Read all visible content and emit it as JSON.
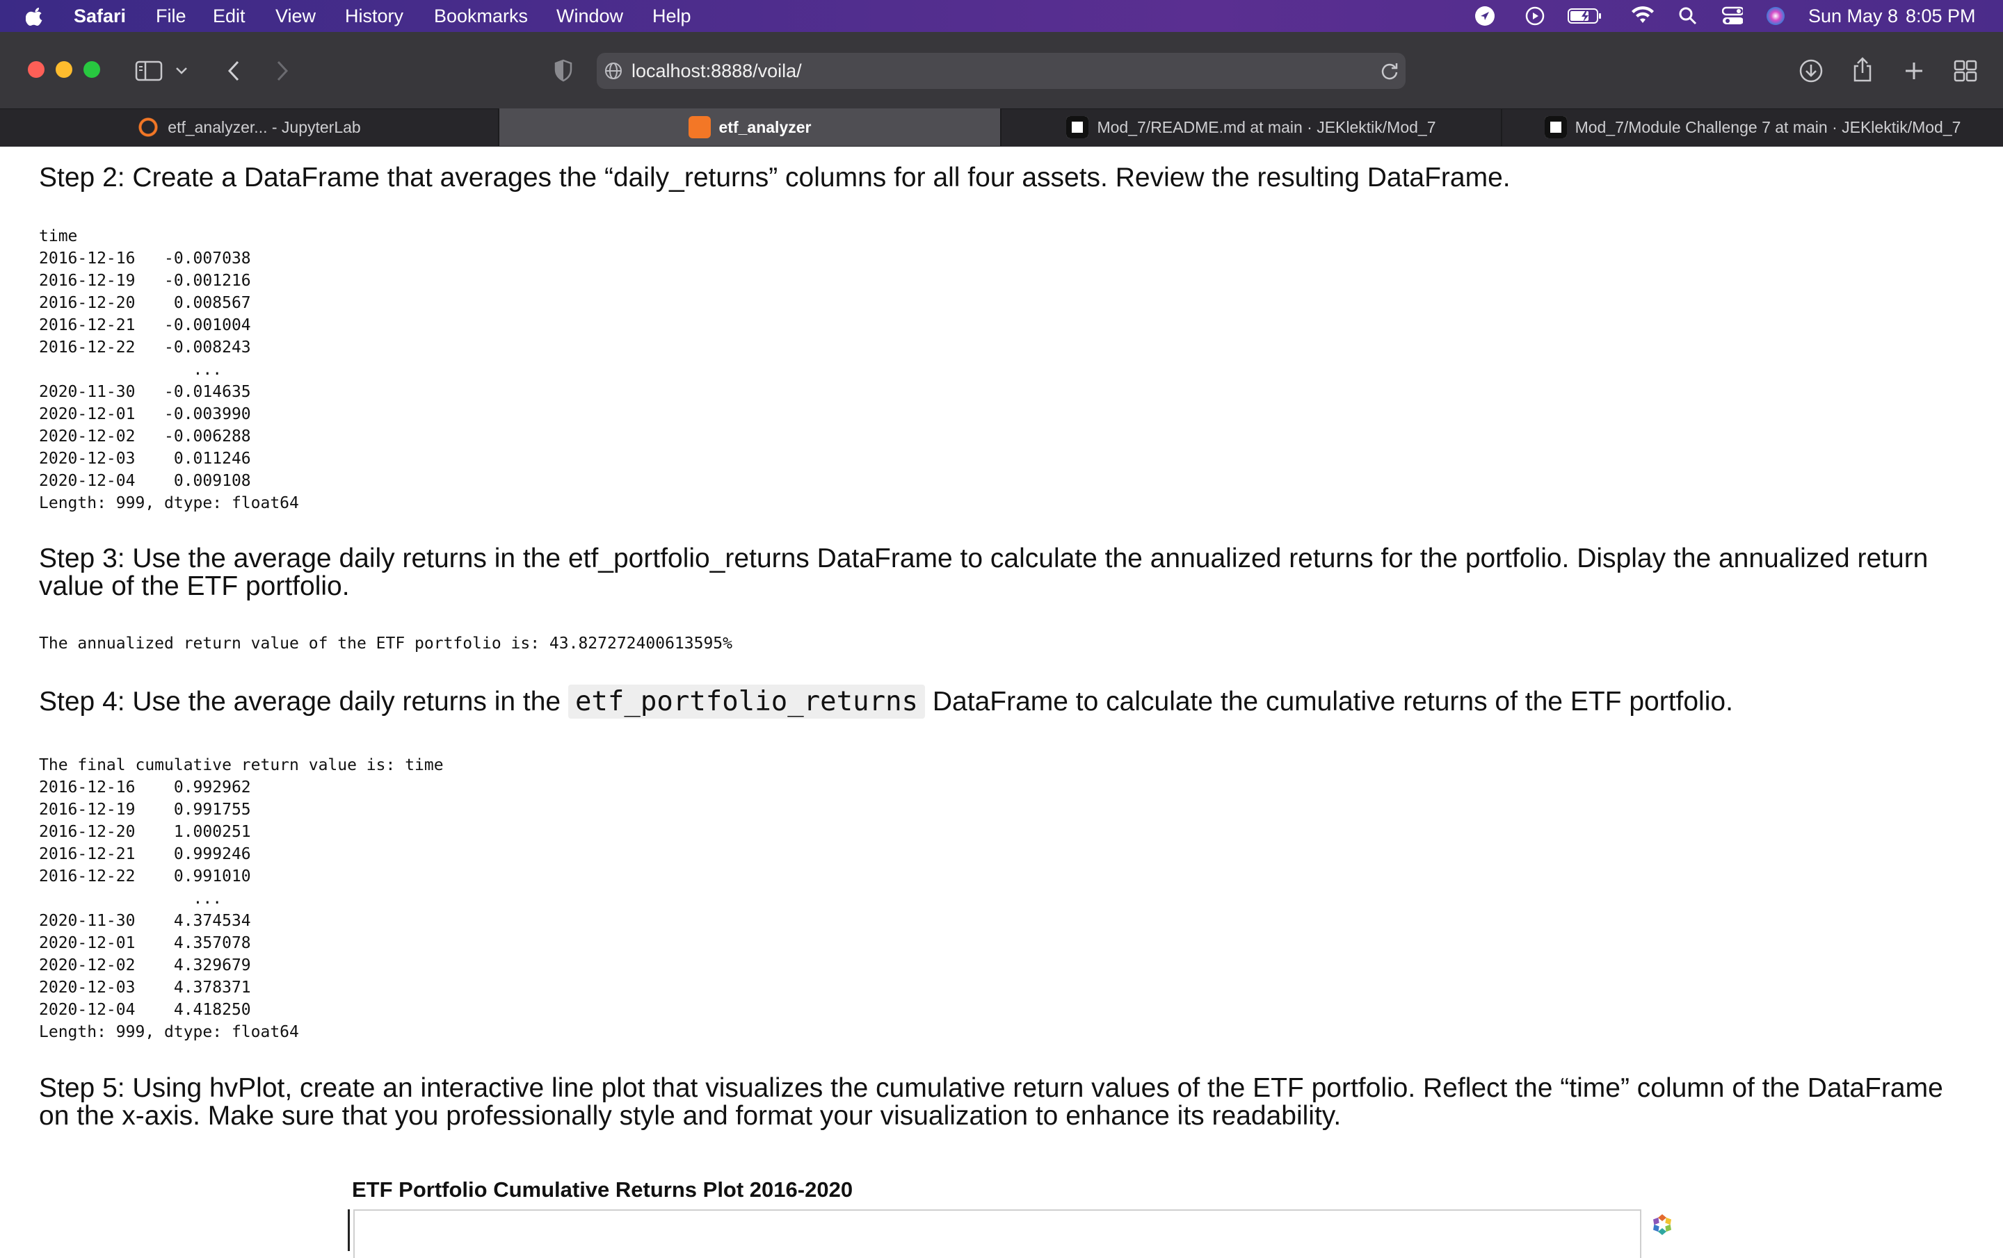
{
  "menubar": {
    "app": "Safari",
    "items": [
      "File",
      "Edit",
      "View",
      "History",
      "Bookmarks",
      "Window",
      "Help"
    ],
    "date": "Sun May 8",
    "time": "8:05 PM",
    "icons": [
      "apple-icon",
      "location-icon",
      "play-icon",
      "battery-icon",
      "wifi-icon",
      "search-icon",
      "control-center-icon",
      "siri-icon"
    ]
  },
  "toolbar": {
    "url": "localhost:8888/voila/"
  },
  "tabs": [
    {
      "label": "etf_analyzer... - JupyterLab",
      "icon": "jupyter-icon"
    },
    {
      "label": "etf_analyzer",
      "icon": "jupyter-icon"
    },
    {
      "label": "Mod_7/README.md at main · JEKlektik/Mod_7",
      "icon": "github-icon"
    },
    {
      "label": "Mod_7/Module Challenge 7 at main · JEKlektik/Mod_7",
      "icon": "github-icon"
    }
  ],
  "content": {
    "step2": {
      "heading": "Step 2: Create a DataFrame that averages the “daily_returns” columns for all four assets. Review the resulting DataFrame.",
      "output": "time\n2016-12-16   -0.007038\n2016-12-19   -0.001216\n2016-12-20    0.008567\n2016-12-21   -0.001004\n2016-12-22   -0.008243\n                ...\n2020-11-30   -0.014635\n2020-12-01   -0.003990\n2020-12-02   -0.006288\n2020-12-03    0.011246\n2020-12-04    0.009108\nLength: 999, dtype: float64"
    },
    "step3": {
      "heading": "Step 3: Use the average daily returns in the etf_portfolio_returns DataFrame to calculate the annualized returns for the portfolio. Display the annualized return value of the ETF portfolio.",
      "output": "The annualized return value of the ETF portfolio is: 43.827272400613595%"
    },
    "step4": {
      "heading_pre": "Step 4: Use the average daily returns in the",
      "heading_code": "etf_portfolio_returns",
      "heading_post": "DataFrame to calculate the cumulative returns of the ETF portfolio.",
      "output": "The final cumulative return value is: time\n2016-12-16    0.992962\n2016-12-19    0.991755\n2016-12-20    1.000251\n2016-12-21    0.999246\n2016-12-22    0.991010\n                ...\n2020-11-30    4.374534\n2020-12-01    4.357078\n2020-12-02    4.329679\n2020-12-03    4.378371\n2020-12-04    4.418250\nLength: 999, dtype: float64"
    },
    "step5": {
      "heading": "Step 5: Using hvPlot, create an interactive line plot that visualizes the cumulative return values of the ETF portfolio. Reflect the “time” column of the DataFrame on the x-axis. Make sure that you professionally style and format your visualization to enhance its readability."
    },
    "plot": {
      "title": "ETF Portfolio Cumulative Returns Plot 2016-2020"
    }
  }
}
